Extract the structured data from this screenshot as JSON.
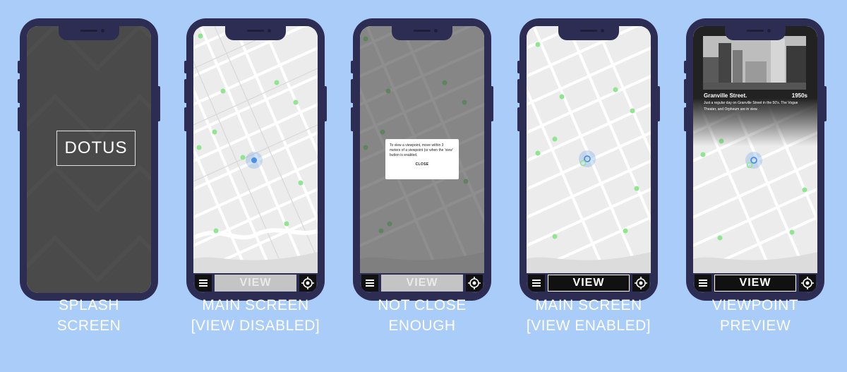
{
  "screens": [
    {
      "id": "splash",
      "caption_lines": [
        "SPLASH",
        "SCREEN"
      ],
      "logo": "DOTUS"
    },
    {
      "id": "main-disabled",
      "caption_lines": [
        "MAIN SCREEN",
        "[VIEW DISABLED]"
      ],
      "view_label": "VIEW",
      "view_state": "disabled"
    },
    {
      "id": "not-close",
      "caption_lines": [
        "NOT CLOSE",
        "ENOUGH"
      ],
      "view_label": "VIEW",
      "view_state": "disabled",
      "modal": {
        "text": "To view a viewpoint, move within 3 meters of a viewpoint (or when the 'view' button is enabled.",
        "close": "CLOSE"
      }
    },
    {
      "id": "main-enabled",
      "caption_lines": [
        "MAIN SCREEN",
        "[VIEW ENABLED]"
      ],
      "view_label": "VIEW",
      "view_state": "enabled"
    },
    {
      "id": "preview",
      "caption_lines": [
        "VIEWPOINT",
        "PREVIEW"
      ],
      "view_label": "VIEW",
      "view_state": "enabled",
      "preview": {
        "title": "Granville Street.",
        "year": "1950s",
        "description": "Just a regular day on Granville Street in the 50's. The Vogue Theater, and Orpheum are in view."
      }
    }
  ],
  "colors": {
    "background": "#a9cdf8",
    "phone": "#2d2c52",
    "marker": "#90e590",
    "user": "#4a90e2"
  },
  "icons": {
    "menu": "hamburger-icon",
    "location": "crosshair-icon"
  }
}
